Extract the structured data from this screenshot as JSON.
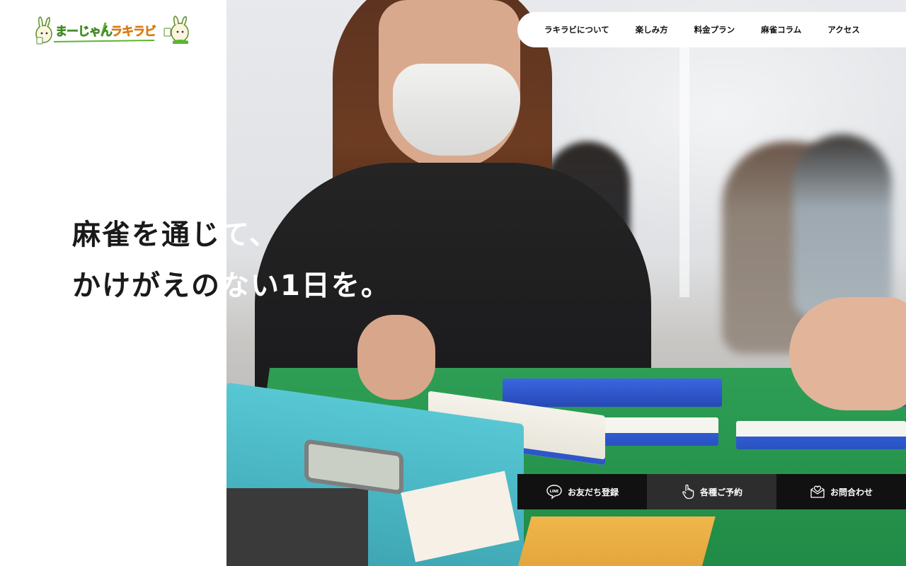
{
  "logo": {
    "left_text": "まーじゃん",
    "right_text": "ラキラビ"
  },
  "nav": {
    "items": [
      {
        "label": "ラキラビについて"
      },
      {
        "label": "楽しみ方"
      },
      {
        "label": "料金プラン"
      },
      {
        "label": "麻雀コラム"
      },
      {
        "label": "アクセス"
      }
    ]
  },
  "hero": {
    "line1_dark": "麻雀を通じ",
    "line1_light": "て、",
    "line2_dark": "かけがえの",
    "line2_light": "ない1日を。"
  },
  "actions": {
    "line_label": "お友だち登録",
    "line_icon_text": "LINE",
    "reserve_label": "各種ご予約",
    "contact_label": "お問合わせ"
  },
  "colors": {
    "logo_green": "#5cb531",
    "logo_orange": "#f39a1e",
    "action_bg": "#111111",
    "action_mid_bg": "#2d2d2d",
    "nav_bg": "#ffffff"
  }
}
